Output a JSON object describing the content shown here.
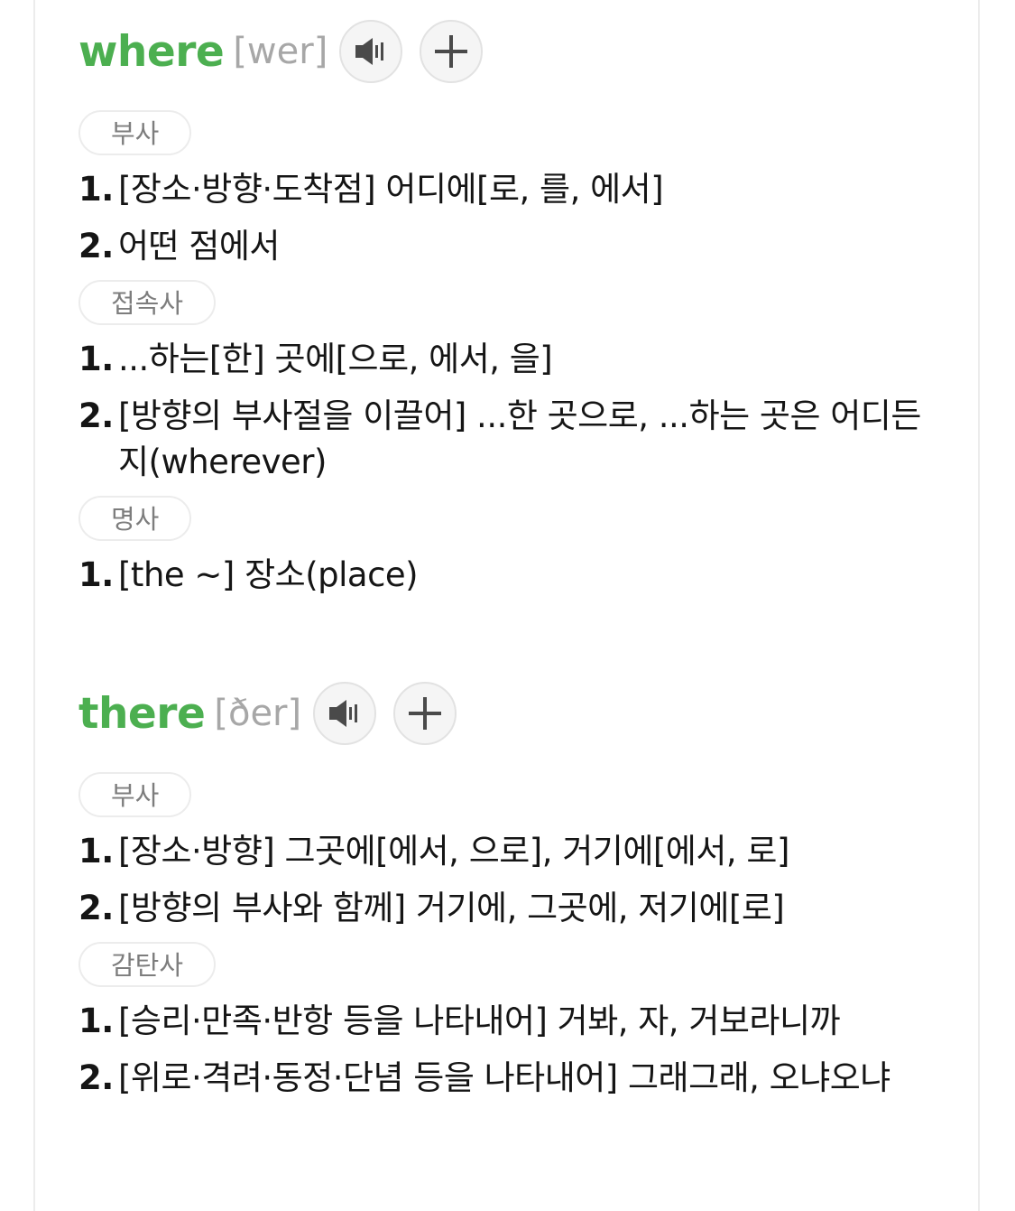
{
  "entries": [
    {
      "word": "where",
      "phonetic": "[wer]",
      "speaker_icon": "speaker-icon",
      "add_icon": "plus-icon",
      "senses": [
        {
          "pos": "부사",
          "definitions": [
            {
              "num": "1.",
              "text": "[장소·방향·도착점] 어디에[로, 를, 에서]"
            },
            {
              "num": "2.",
              "text": "어떤 점에서"
            }
          ]
        },
        {
          "pos": "접속사",
          "definitions": [
            {
              "num": "1.",
              "text": "...하는[한] 곳에[으로, 에서, 을]"
            },
            {
              "num": "2.",
              "text": "[방향의 부사절을 이끌어] ...한 곳으로, ...하는 곳은 어디든지(wherever)"
            }
          ]
        },
        {
          "pos": "명사",
          "definitions": [
            {
              "num": "1.",
              "text": "[the ~] 장소(place)"
            }
          ]
        }
      ]
    },
    {
      "word": "there",
      "phonetic": "[ðer]",
      "speaker_icon": "speaker-icon",
      "add_icon": "plus-icon",
      "senses": [
        {
          "pos": "부사",
          "definitions": [
            {
              "num": "1.",
              "text": "[장소·방향] 그곳에[에서, 으로], 거기에[에서, 로]"
            },
            {
              "num": "2.",
              "text": "[방향의 부사와 함께] 거기에, 그곳에, 저기에[로]"
            }
          ]
        },
        {
          "pos": "감탄사",
          "definitions": [
            {
              "num": "1.",
              "text": "[승리·만족·반항 등을 나타내어] 거봐, 자, 거보라니까"
            },
            {
              "num": "2.",
              "text": "[위로·격려·동정·단념 등을 나타내어] 그래그래, 오냐오냐"
            }
          ]
        }
      ]
    }
  ],
  "colors": {
    "headword": "#4caf50",
    "phonetic": "#a7a7a7",
    "badge_text": "#7d7d7d",
    "badge_border": "#ececec",
    "definition_text": "#151515"
  }
}
